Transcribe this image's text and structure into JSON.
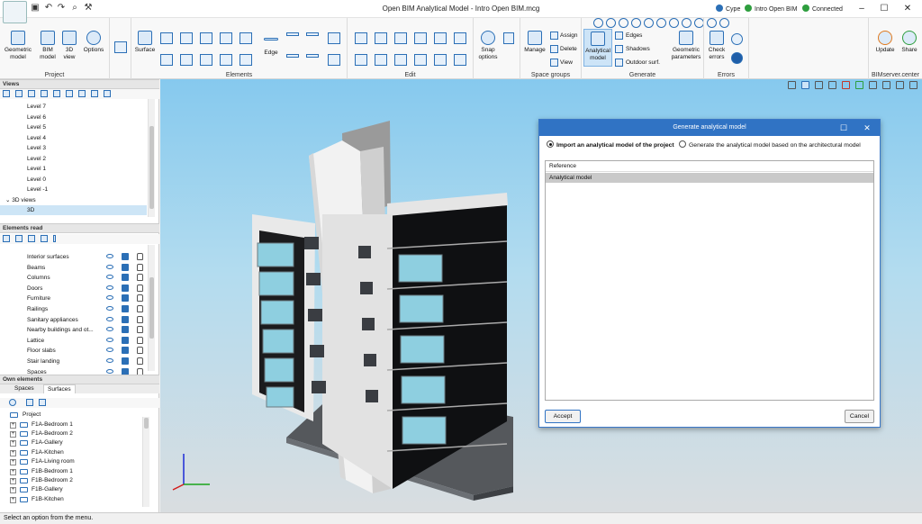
{
  "app": {
    "title": "Open BIM Analytical Model - Intro Open BIM.mcg"
  },
  "topright": {
    "cype": "Cype",
    "project": "Intro Open BIM",
    "connection": "Connected"
  },
  "ribbon": {
    "project": {
      "label": "Project",
      "geometric": "Geometric model",
      "bim": "BIM model",
      "view3d": "3D view",
      "options": "Options"
    },
    "elements": {
      "label": "Elements",
      "surface": "Surface",
      "edge": "Edge"
    },
    "edit": {
      "label": "Edit",
      "snap": "Snap options"
    },
    "space_groups": {
      "label": "Space groups",
      "manage": "Manage",
      "assign": "Assign",
      "delete": "Delete",
      "view": "View"
    },
    "generate": {
      "label": "Generate",
      "analytical": "Analytical model",
      "edges": "Edges",
      "shadows": "Shadows",
      "outdoor": "Outdoor surf.",
      "geometric_params": "Geometric parameters"
    },
    "errors": {
      "label": "Errors",
      "check": "Check errors"
    },
    "bimserver": {
      "label": "BIMserver.center",
      "update": "Update",
      "share": "Share"
    }
  },
  "views": {
    "header": "Views",
    "items": [
      "Level 7",
      "Level 6",
      "Level 5",
      "Level 4",
      "Level 3",
      "Level 2",
      "Level 1",
      "Level 0",
      "Level -1"
    ],
    "group": "3D views",
    "selected": "3D"
  },
  "elements_read": {
    "header": "Elements read",
    "items": [
      "Interior surfaces",
      "Beams",
      "Columns",
      "Doors",
      "Furniture",
      "Railings",
      "Sanitary appliances",
      "Nearby buildings and ot...",
      "Lattice",
      "Floor slabs",
      "Stair landing",
      "Spaces"
    ]
  },
  "own_elements": {
    "header": "Own elements",
    "tabs": [
      "Spaces",
      "Surfaces"
    ],
    "root": "Project",
    "items": [
      "F1A-Bedroom 1",
      "F1A-Bedroom 2",
      "F1A-Gallery",
      "F1A-Kitchen",
      "F1A-Living room",
      "F1B-Bedroom 1",
      "F1B-Bedroom 2",
      "F1B-Gallery",
      "F1B-Kitchen"
    ]
  },
  "dialog": {
    "title": "Generate analytical model",
    "option1": "Import an analytical model of the project",
    "option2": "Generate the analytical model based on the architectural model",
    "list_header": "Reference",
    "list_item": "Analytical model",
    "accept": "Accept",
    "cancel": "Cancel"
  },
  "status": {
    "text": "Select an option from the menu."
  },
  "colors": {
    "accent": "#3073c4",
    "icon_blue": "#2b6fb6",
    "connected": "#2e9e3e"
  }
}
